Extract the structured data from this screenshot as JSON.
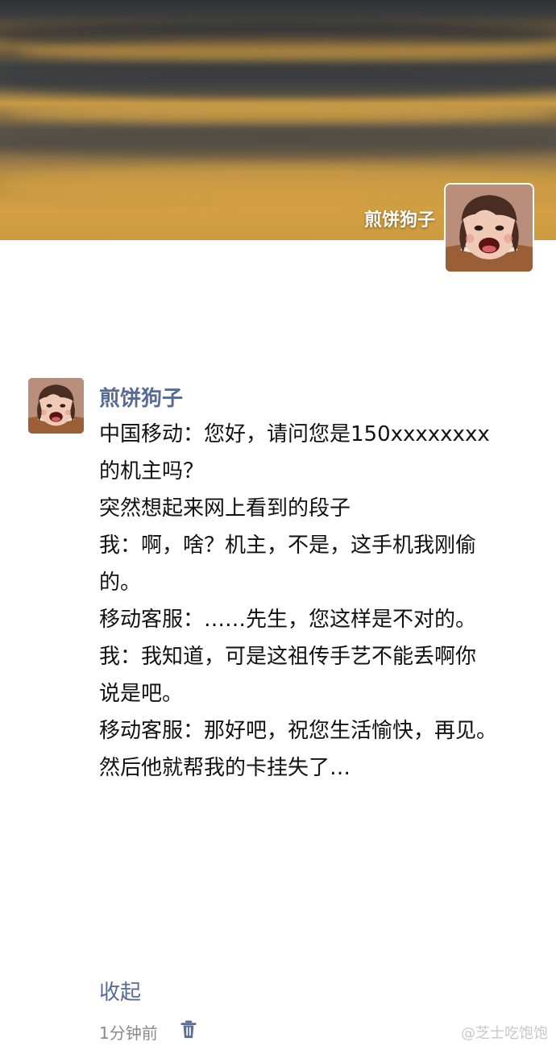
{
  "profile": {
    "cover_name": "煎饼狗子",
    "accent_color": "#576b95",
    "cover_colors": [
      "#2e3238",
      "#b8913f",
      "#c69641"
    ],
    "avatar_icon": "crying-child-avatar"
  },
  "post": {
    "author": "煎饼狗子",
    "text_lines": [
      "中国移动：您好，请问您是150xxxxxxxx",
      "的机主吗？",
      "",
      "突然想起来网上看到的段子",
      "",
      "我：啊，啥？机主，不是，这手机我刚偷",
      "的。",
      "",
      "移动客服：……先生，您这样是不对的。",
      "",
      "我：我知道，可是这祖传手艺不能丢啊你",
      "说是吧。",
      "",
      "移动客服：那好吧，祝您生活愉快，再见。",
      "",
      "然后他就帮我的卡挂失了…"
    ],
    "collapse_label": "收起",
    "time": "1分钟前",
    "delete_icon": "trash-icon"
  },
  "watermark": {
    "text": "@芝士吃饱饱"
  }
}
